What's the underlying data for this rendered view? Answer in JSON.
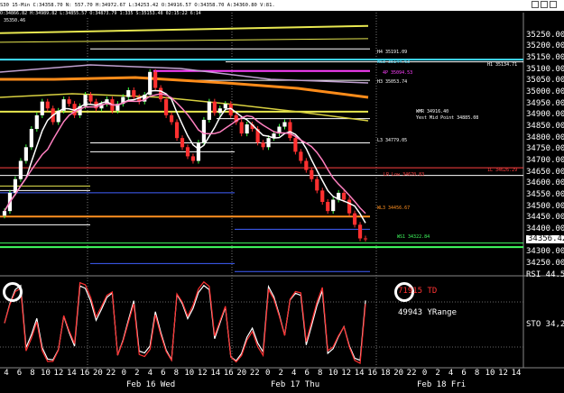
{
  "header": {
    "symbol": "S30",
    "interval": "15-Min",
    "close": "C:34358.70",
    "net": "N: 557.70",
    "high": "H:34972.67",
    "low": "L:34253.42",
    "open": "O:34916.57",
    "extra": "O:34358.70  A:34360.80  V:81."
  },
  "header_line2": "O:34866.82  H:34989.82  L:34855.57  O:34873.79  1:335  S:35153.48  02:15:22  6:14",
  "top_left_label": "35350.46",
  "annotations": [
    {
      "text": "H4 35191.09",
      "color": "#ffffff"
    },
    {
      "text": "WS3 35144.63",
      "color": "#40e0ff"
    },
    {
      "text": "H1 35134.71",
      "color": "#ffffff"
    },
    {
      "text": "4P 35094.53",
      "color": "#ff40ff"
    },
    {
      "text": "H3 35053.74",
      "color": "#ffffff"
    },
    {
      "text": "WMR 34916.40",
      "color": "#ffffff"
    },
    {
      "text": "Yest Mid Point 34885.08",
      "color": "#ffffff"
    },
    {
      "text": "L3 34779.05",
      "color": "#ffffff"
    },
    {
      "text": "LR Low 34670.83",
      "color": "#ff4040"
    },
    {
      "text": "1L 34626.29",
      "color": "#ff4040"
    },
    {
      "text": "WL3 34456.67",
      "color": "#ff9020"
    },
    {
      "text": "WS1 34322.84",
      "color": "#40ff60"
    }
  ],
  "price_axis": {
    "labels": [
      "35250.00",
      "35200.00",
      "35150.00",
      "35100.00",
      "35050.00",
      "35000.00",
      "34950.00",
      "34900.00",
      "34850.00",
      "34800.00",
      "34750.00",
      "34700.00",
      "34650.00",
      "34600.00",
      "34550.00",
      "34500.00",
      "34450.00",
      "34400.00",
      "34300.00",
      "34250.00"
    ],
    "last_price": "34356.42",
    "osc_labels": [
      "RSI 44.5",
      "STO 34,2"
    ]
  },
  "x_axis": {
    "ticks": [
      "4",
      "6",
      "8",
      "10",
      "12",
      "14",
      "16",
      "20",
      "22",
      "0",
      "2",
      "4",
      "6",
      "8",
      "10",
      "12",
      "14",
      "16",
      "20",
      "22",
      "0",
      "2",
      "4",
      "6",
      "8",
      "10",
      "12",
      "14",
      "16",
      "18",
      "20",
      "22",
      "0",
      "2",
      "4",
      "6",
      "8",
      "10",
      "12",
      "14"
    ],
    "days": [
      "Feb 16 Wed",
      "Feb 17 Thu",
      "Feb 18 Fri"
    ]
  },
  "oscillator": {
    "td_label": "71915 TD",
    "yrange_label": "49943 YRange"
  },
  "colors": {
    "up_candle": "#ffffff",
    "down_candle": "#ff3030",
    "wick_up": "#40ff40",
    "yellow": "#e8e850",
    "orange": "#ff8c1a",
    "pink": "#ff80c0",
    "grey_ma": "#c0c0c0"
  },
  "chart_data": {
    "type": "candlestick",
    "ylim": [
      34200,
      35350
    ],
    "series": [
      {
        "values": [
          34480,
          34560,
          34620,
          34700,
          34760,
          34840,
          34900,
          34960,
          34930,
          34870,
          34920,
          34970,
          34950,
          34900,
          34940,
          34990,
          34960,
          34930,
          34950,
          34970,
          34920,
          34950,
          34980,
          35010,
          34980,
          34960,
          34990,
          35090,
          35020,
          34970,
          34900,
          34870,
          34800,
          34760,
          34720,
          34700,
          34780,
          34880,
          34960,
          34910,
          34930,
          34950,
          34900,
          34870,
          34820,
          34860,
          34840,
          34780,
          34760,
          34800,
          34820,
          34850,
          34870,
          34800,
          34740,
          34700,
          34660,
          34620,
          34570,
          34520,
          34480,
          34530,
          34560,
          34530,
          34470,
          34420,
          34360,
          34358
        ]
      }
    ]
  }
}
